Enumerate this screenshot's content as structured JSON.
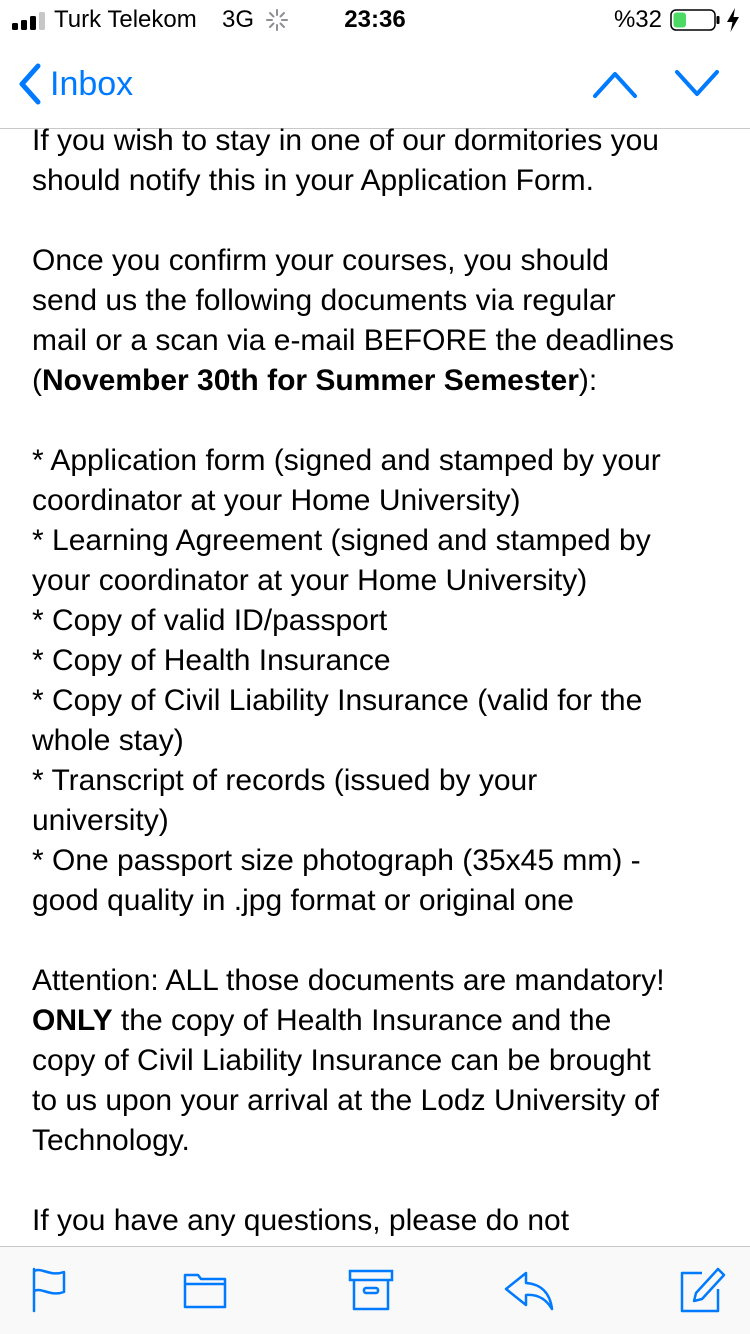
{
  "status_bar": {
    "carrier": "Turk Telekom",
    "network": "3G",
    "time": "23:36",
    "battery_percent": "%32",
    "battery_level": 0.32,
    "battery_color": "#4cd964"
  },
  "nav": {
    "back_label": "Inbox",
    "accent_color": "#007aff",
    "icons": [
      "chevron-left-icon",
      "chevron-up-icon",
      "chevron-down-icon"
    ]
  },
  "message": {
    "p1": [
      "If you wish to stay in one of our dormitories you",
      "should notify this in your Application Form."
    ],
    "p2": {
      "lines": [
        "Once you confirm your courses, you should",
        "send us the following documents via regular",
        "mail or a scan via e-mail BEFORE the deadlines"
      ],
      "deadline_prefix": "(",
      "deadline_bold": "November 30th for Summer Semester",
      "deadline_suffix": "):"
    },
    "list": [
      "* Application form (signed and stamped by your",
      "coordinator at your Home University)",
      "* Learning Agreement (signed and stamped by",
      "your coordinator at your Home University)",
      "* Copy of valid ID/passport",
      "* Copy of Health Insurance",
      "* Copy of Civil Liability Insurance (valid for the",
      "whole stay)",
      "* Transcript of records (issued by your",
      "university)",
      "* One passport size photograph (35x45 mm)  -",
      "good quality in .jpg format or original one"
    ],
    "attention": {
      "line1": "Attention: ALL those documents are mandatory!",
      "only_bold": "ONLY",
      "line2_rest": " the copy of Health Insurance and the",
      "lines": [
        "copy of Civil Liability Insurance can be brought",
        "to us upon your arrival at the Lodz University of",
        "Technology."
      ]
    },
    "closing": "If you have any questions, please do not"
  },
  "toolbar": {
    "icons": [
      "flag-icon",
      "folder-icon",
      "archive-icon",
      "reply-icon",
      "compose-icon"
    ]
  }
}
